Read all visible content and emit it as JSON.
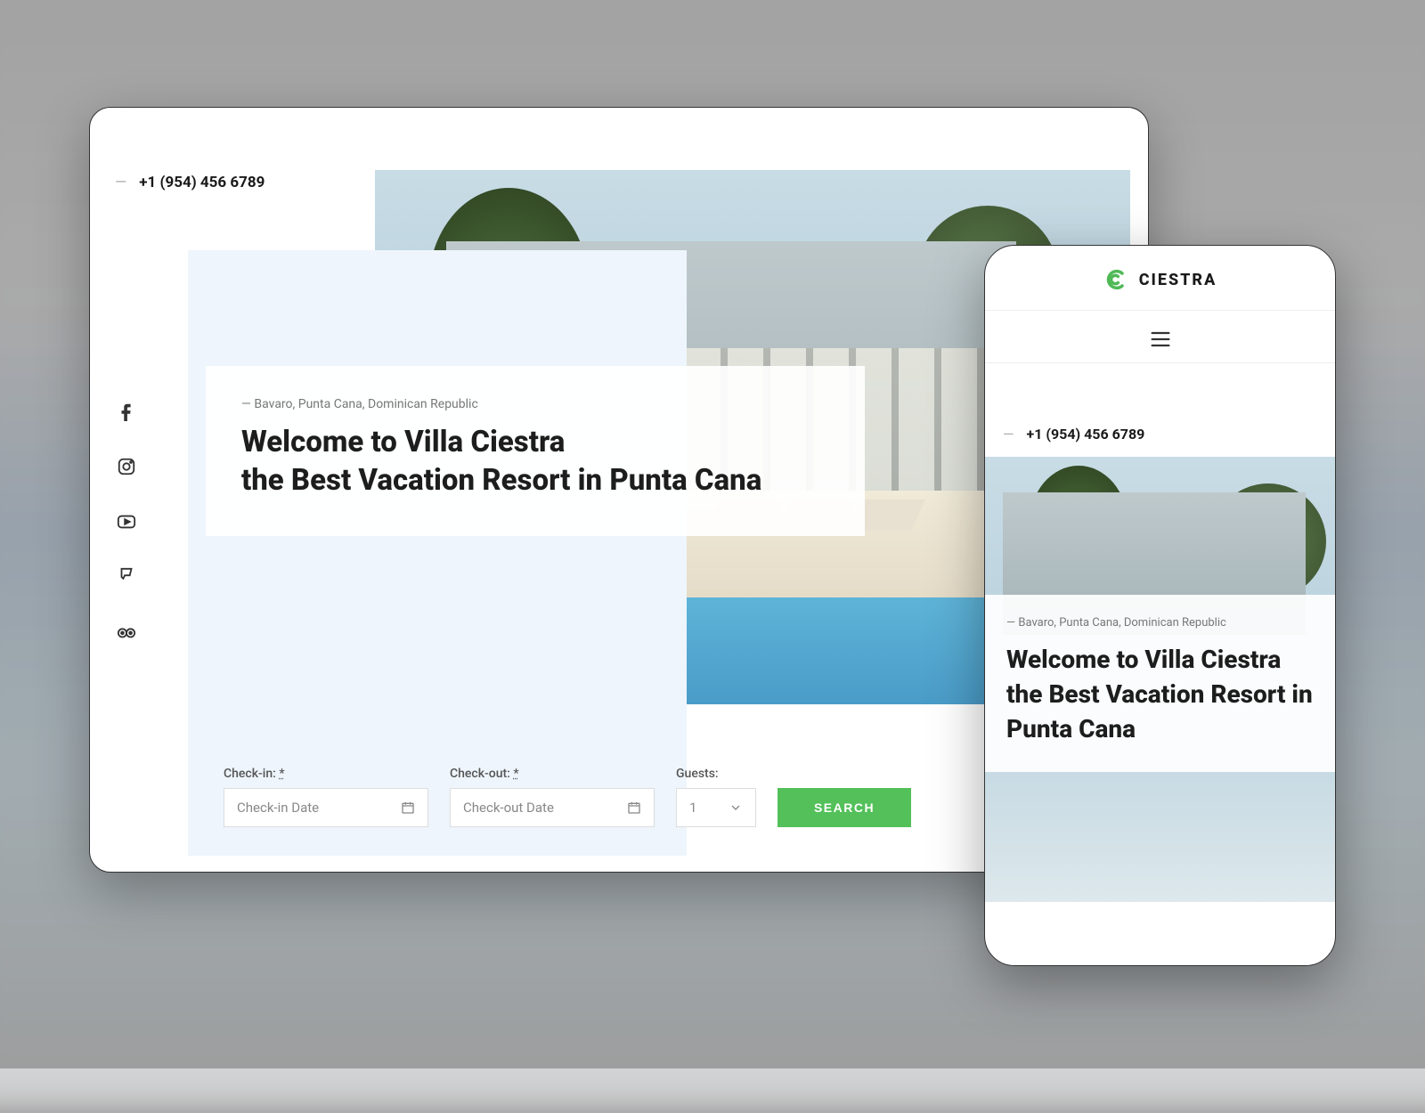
{
  "desktop": {
    "phone": "+1 (954) 456 6789",
    "location_tag": "— Bavaro, Punta Cana, Dominican Republic",
    "welcome_line1": "Welcome to Villa Ciestra",
    "welcome_line2": "the Best Vacation Resort in Punta Cana",
    "form": {
      "checkin_label": "Check-in:",
      "checkin_asterisk": "*",
      "checkin_placeholder": "Check-in Date",
      "checkout_label": "Check-out:",
      "checkout_asterisk": "*",
      "checkout_placeholder": "Check-out Date",
      "guests_label": "Guests:",
      "guests_value": "1",
      "search_label": "SEARCH"
    },
    "social": [
      "facebook",
      "instagram",
      "youtube",
      "foursquare",
      "tripadvisor"
    ]
  },
  "mobile": {
    "brand": "CIESTRA",
    "phone": "+1 (954) 456 6789",
    "location_tag": "— Bavaro, Punta Cana, Dominican Republic",
    "welcome_title": "Welcome to Villa Ciestra the Best Vacation Resort in Punta Cana"
  },
  "colors": {
    "accent": "#53c05a"
  }
}
